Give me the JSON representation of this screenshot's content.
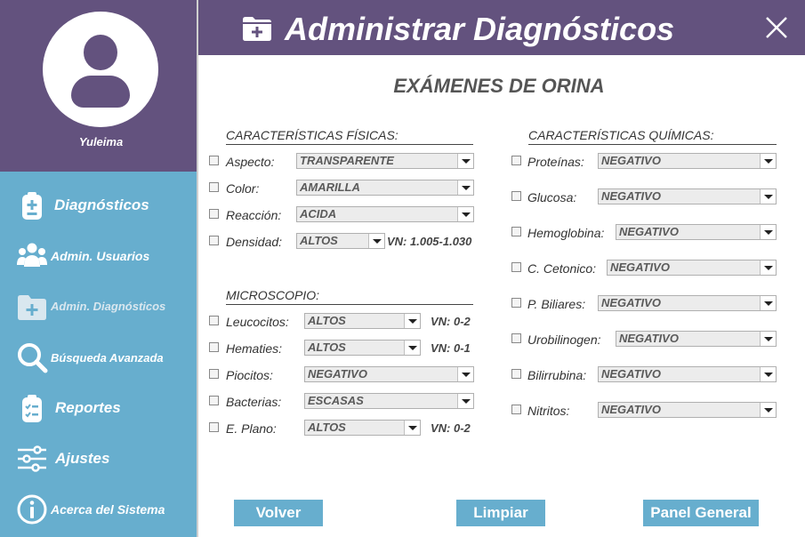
{
  "sidebar": {
    "username": "Yuleima",
    "items": [
      {
        "label": "Diagnósticos",
        "icon": "clipboard-plus-icon"
      },
      {
        "label": "Admin. Usuarios",
        "icon": "users-icon"
      },
      {
        "label": "Admin. Diagnósticos",
        "icon": "folder-plus-icon",
        "active": true
      },
      {
        "label": "Búsqueda Avanzada",
        "icon": "search-icon"
      },
      {
        "label": "Reportes",
        "icon": "clipboard-check-icon"
      },
      {
        "label": "Ajustes",
        "icon": "sliders-icon"
      },
      {
        "label": "Acerca del Sistema",
        "icon": "info-icon"
      }
    ]
  },
  "header": {
    "title": "Administrar Diagnósticos",
    "icon": "folder-plus-icon"
  },
  "section_title": "EXÁMENES DE ORINA",
  "fisicas": {
    "title": "CARACTERÍSTICAS FÍSICAS:",
    "rows": [
      {
        "label": "Aspecto:",
        "value": "TRANSPARENTE"
      },
      {
        "label": "Color:",
        "value": "AMARILLA"
      },
      {
        "label": "Reacción:",
        "value": "ACIDA"
      },
      {
        "label": "Densidad:",
        "value": "ALTOS",
        "vn": "VN: 1.005-1.030"
      }
    ]
  },
  "microscopio": {
    "title": "MICROSCOPIO:",
    "rows": [
      {
        "label": "Leucocitos:",
        "value": "ALTOS",
        "vn": "VN: 0-2"
      },
      {
        "label": "Hematies:",
        "value": "ALTOS",
        "vn": "VN: 0-1"
      },
      {
        "label": "Piocitos:",
        "value": "NEGATIVO"
      },
      {
        "label": "Bacterias:",
        "value": "ESCASAS"
      },
      {
        "label": "E. Plano:",
        "value": "ALTOS",
        "vn": "VN: 0-2"
      }
    ]
  },
  "quimicas": {
    "title": "CARACTERÍSTICAS QUÍMICAS:",
    "rows": [
      {
        "label": "Proteínas:",
        "value": "NEGATIVO"
      },
      {
        "label": "Glucosa:",
        "value": "NEGATIVO"
      },
      {
        "label": "Hemoglobina:",
        "value": "NEGATIVO"
      },
      {
        "label": "C. Cetonico:",
        "value": "NEGATIVO"
      },
      {
        "label": "P. Biliares:",
        "value": "NEGATIVO"
      },
      {
        "label": "Urobilinogen:",
        "value": "NEGATIVO"
      },
      {
        "label": "Bilirrubina:",
        "value": "NEGATIVO"
      },
      {
        "label": "Nitritos:",
        "value": "NEGATIVO"
      }
    ]
  },
  "buttons": {
    "back": "Volver",
    "clear": "Limpiar",
    "panel": "Panel General"
  },
  "colors": {
    "purple": "#63527e",
    "blue": "#67aece"
  }
}
